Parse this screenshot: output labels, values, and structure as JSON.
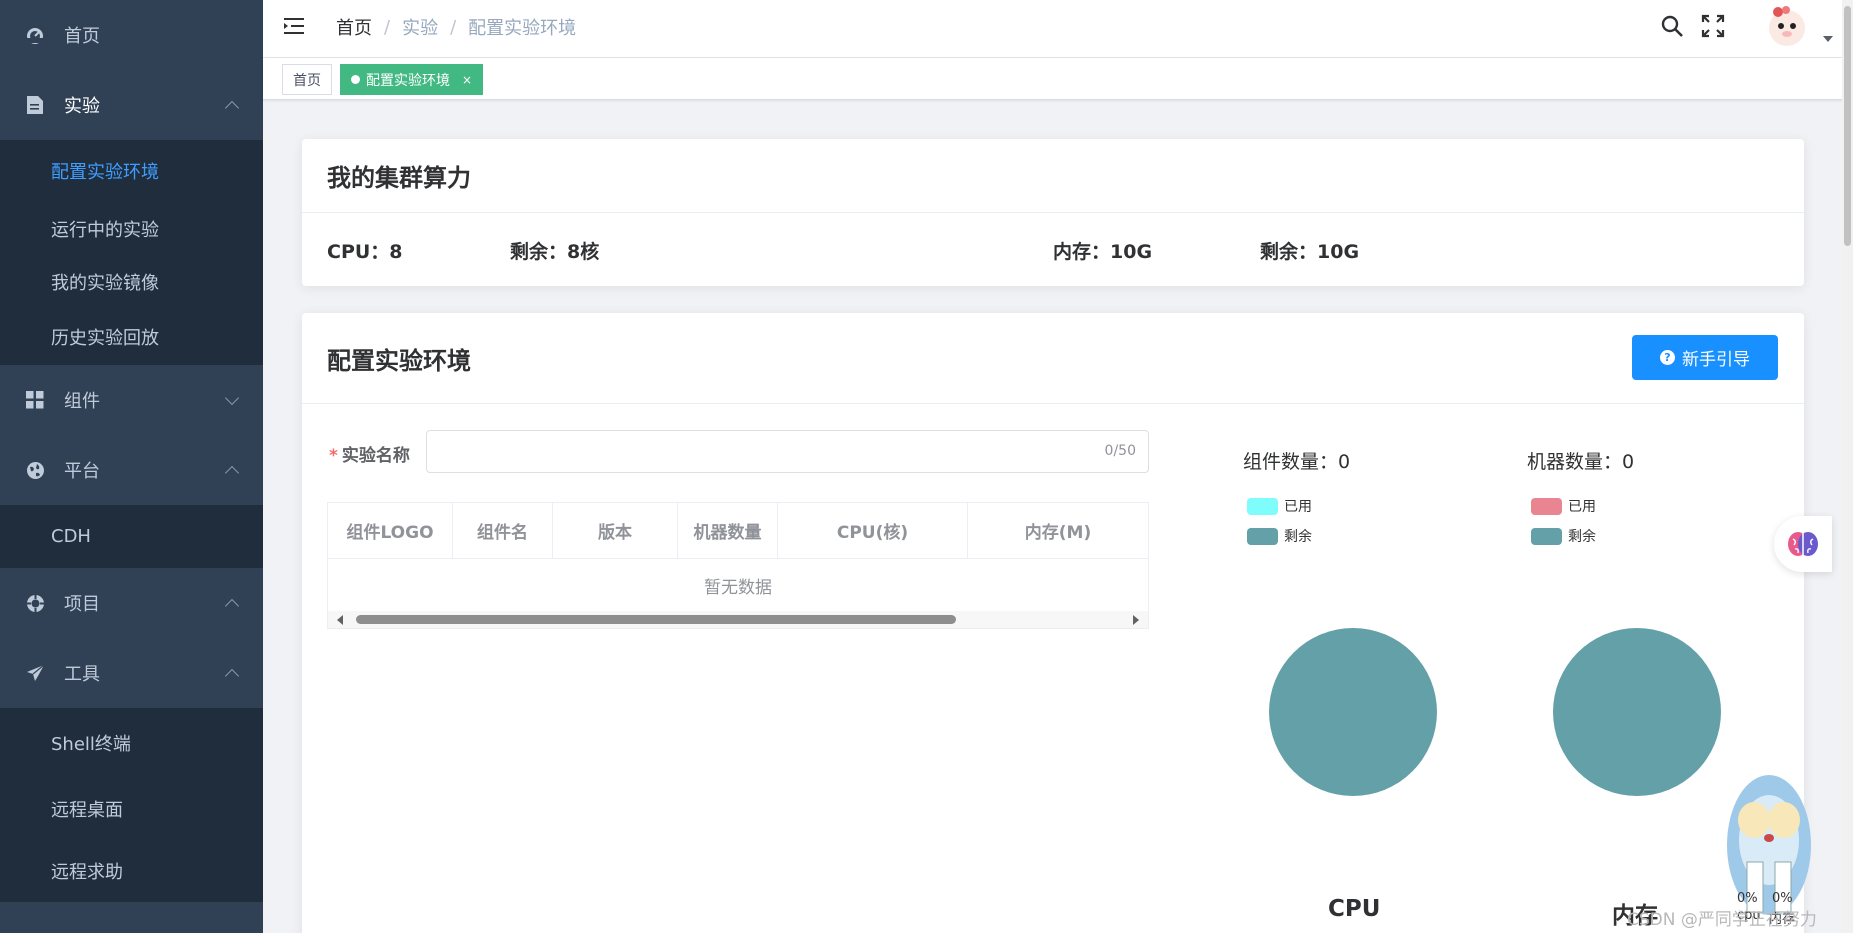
{
  "sidebar": {
    "items": [
      {
        "label": "首页"
      },
      {
        "label": "实验",
        "children": [
          "配置实验环境",
          "运行中的实验",
          "我的实验镜像",
          "历史实验回放"
        ]
      },
      {
        "label": "组件"
      },
      {
        "label": "平台",
        "children": [
          "CDH"
        ]
      },
      {
        "label": "项目"
      },
      {
        "label": "工具",
        "children": [
          "Shell终端",
          "远程桌面",
          "远程求助"
        ]
      }
    ]
  },
  "navbar": {
    "breadcrumb": [
      "首页",
      "实验",
      "配置实验环境"
    ],
    "separator": "/"
  },
  "tags": {
    "home": "首页",
    "active": "配置实验环境",
    "close": "×"
  },
  "cluster": {
    "title": "我的集群算力",
    "cpu": "CPU：8",
    "cpu_left": "剩余：8核",
    "mem": "内存：10G",
    "mem_left": "剩余：10G"
  },
  "config": {
    "title": "配置实验环境",
    "guide_button": "新手引导",
    "name_label": "实验名称",
    "required_mark": "*",
    "name_value": "",
    "name_count": "0/50",
    "table": {
      "columns": [
        "组件LOGO",
        "组件名",
        "版本",
        "机器数量",
        "CPU(核)",
        "内存(M)"
      ],
      "empty_text": "暂无数据"
    },
    "component_count": "组件数量：0",
    "machine_count": "机器数量：0",
    "legend_used": "已用",
    "legend_left": "剩余",
    "colors": {
      "cpu_used": "#7ffcfc",
      "mem_used": "#e98590",
      "remaining": "#63a0a8"
    },
    "pie_cpu": "CPU",
    "pie_mem": "内存"
  },
  "chart_data": [
    {
      "type": "pie",
      "title": "CPU",
      "categories": [
        "已用",
        "剩余"
      ],
      "values": [
        0,
        8
      ]
    },
    {
      "type": "pie",
      "title": "内存",
      "categories": [
        "已用",
        "剩余"
      ],
      "values": [
        0,
        10
      ]
    }
  ],
  "mascot": {
    "cpu_pct": "0%",
    "mem_pct": "0%",
    "cpu_label": "cpu",
    "mem_label": "内存"
  },
  "watermark": "CSDN @严同学正在努力"
}
